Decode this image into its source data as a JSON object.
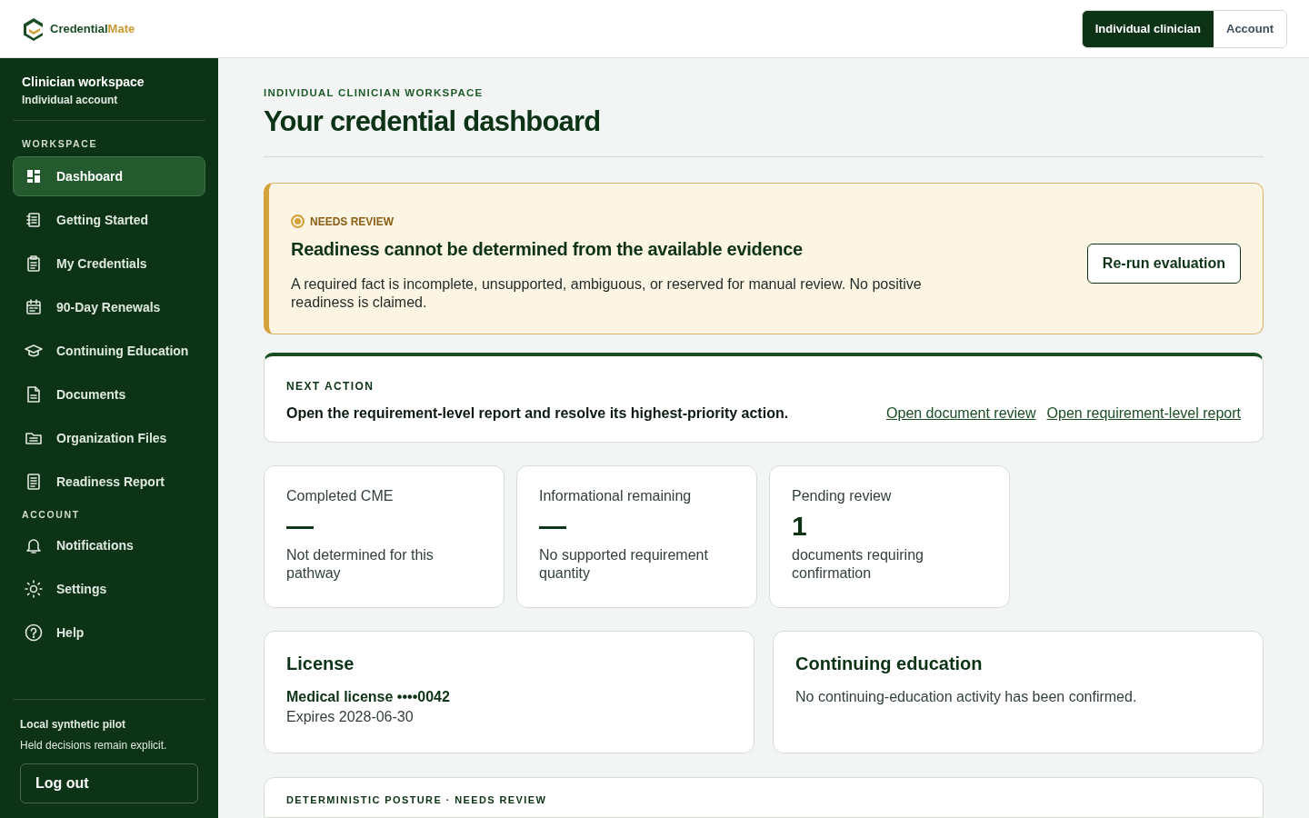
{
  "header": {
    "logo": {
      "part_1": "Credential",
      "part_2": "Mate"
    },
    "role_tabs": [
      {
        "label": "Individual clinician",
        "selected": true
      },
      {
        "label": "Account",
        "selected": false
      }
    ]
  },
  "sidebar": {
    "workspace_title": "Clinician workspace",
    "workspace_subtitle": "Individual account",
    "sections": [
      {
        "heading": "WORKSPACE",
        "items": [
          {
            "label": "Dashboard",
            "kind": "dashboard",
            "selected": true
          },
          {
            "label": "Getting Started",
            "kind": "list",
            "selected": false
          },
          {
            "label": "My Credentials",
            "kind": "clipboard",
            "selected": false
          },
          {
            "label": "90-Day Renewals",
            "kind": "calendar",
            "selected": false
          },
          {
            "label": "Continuing Education",
            "kind": "cap",
            "selected": false
          },
          {
            "label": "Documents",
            "kind": "document",
            "selected": false
          },
          {
            "label": "Organization Files",
            "kind": "folder",
            "selected": false
          },
          {
            "label": "Readiness Report",
            "kind": "report",
            "selected": false
          }
        ]
      },
      {
        "heading": "ACCOUNT",
        "items": [
          {
            "label": "Notifications",
            "kind": "bell",
            "selected": false
          },
          {
            "label": "Settings",
            "kind": "sun",
            "selected": false
          },
          {
            "label": "Help",
            "kind": "help",
            "selected": false
          }
        ]
      }
    ],
    "footer": {
      "title": "Local synthetic pilot",
      "note": "Held decisions remain explicit.",
      "logout": "Log out"
    }
  },
  "page": {
    "eyebrow": "INDIVIDUAL CLINICIAN WORKSPACE",
    "title": "Your credential dashboard"
  },
  "alert": {
    "status": "NEEDS REVIEW",
    "title": "Readiness cannot be determined from the available evidence",
    "body": "A required fact is incomplete, unsupported, ambiguous, or reserved for manual review. No positive readiness is claimed.",
    "button": "Re-run evaluation"
  },
  "next_action": {
    "heading": "NEXT ACTION",
    "text": "Open the requirement-level report and resolve its highest-priority action.",
    "links": [
      "Open document review",
      "Open requirement-level report"
    ]
  },
  "metrics": [
    {
      "label": "Completed CME",
      "value": "—",
      "note": "Not determined for this pathway"
    },
    {
      "label": "Informational remaining",
      "value": "—",
      "note": "No supported requirement quantity"
    },
    {
      "label": "Pending review",
      "value": "1",
      "note": "documents requiring confirmation"
    }
  ],
  "cards": [
    {
      "title": "License",
      "subtitle": "Medical license ••••0042",
      "detail": "Expires 2028-06-30"
    },
    {
      "title": "Continuing education",
      "detail": "No continuing-education activity has been confirmed."
    }
  ],
  "posture": {
    "heading": "DETERMINISTIC POSTURE · NEEDS REVIEW"
  }
}
